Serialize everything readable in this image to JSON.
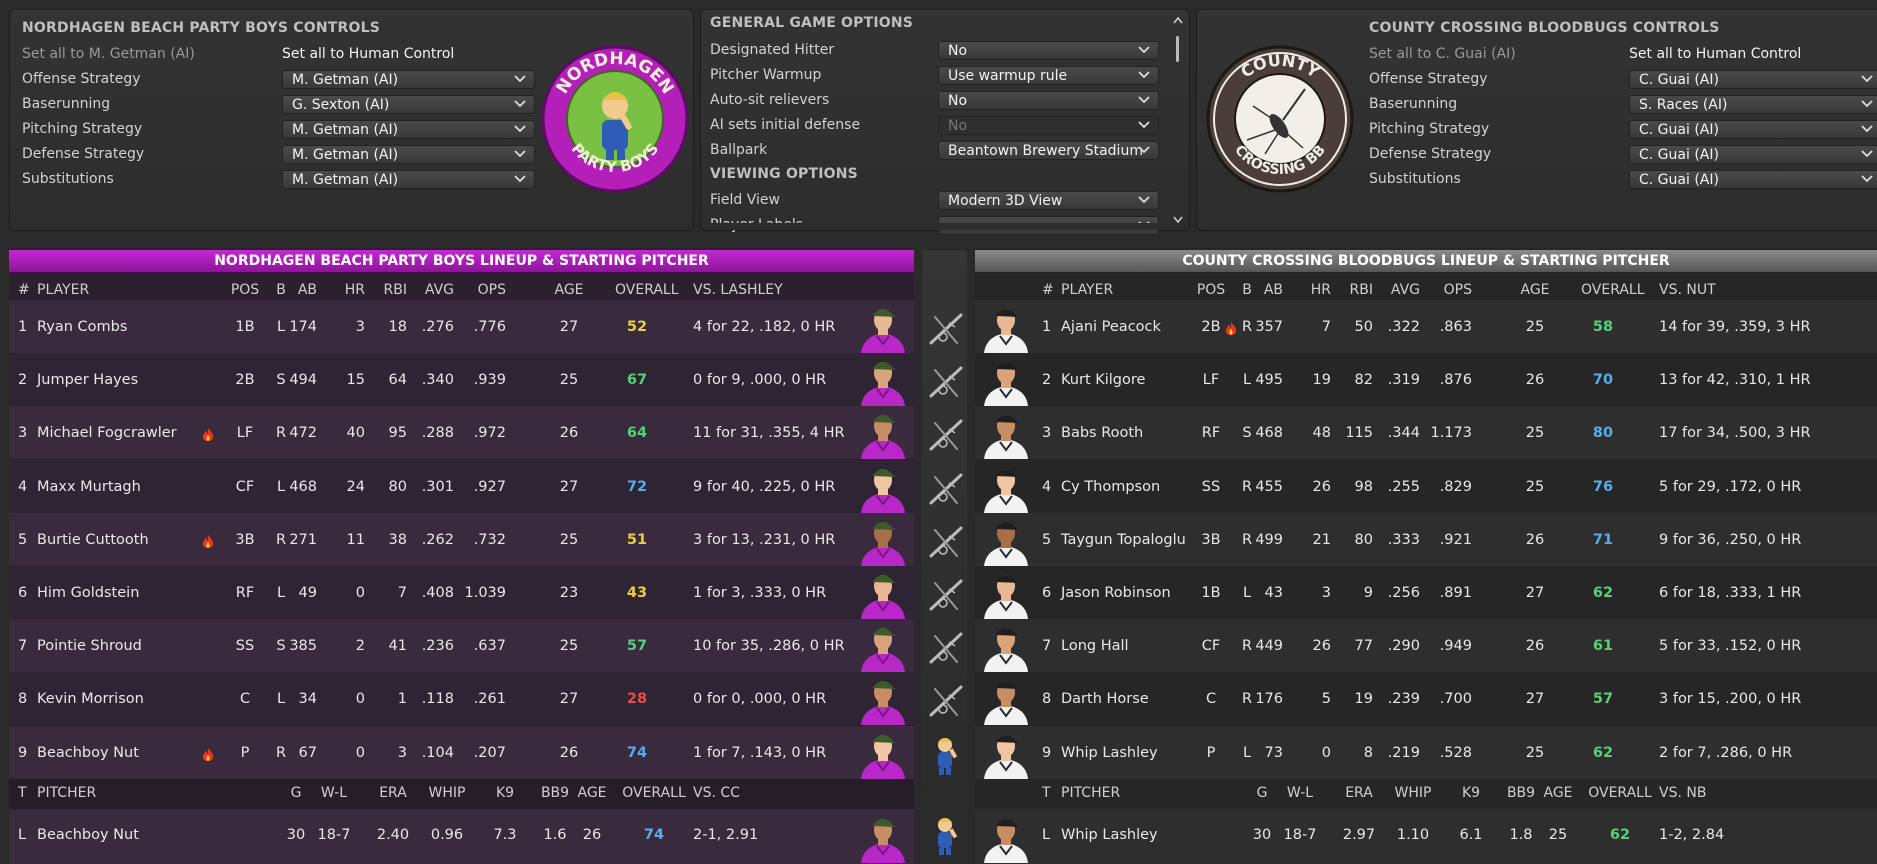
{
  "colors": {
    "away_header": "#a01ab0",
    "home_header": "#6a6a6a",
    "ovr_yellow": "#e9d13a",
    "ovr_green": "#55d07a",
    "ovr_blue": "#55aee8",
    "ovr_red": "#e84b4b"
  },
  "away_controls": {
    "title": "NORDHAGEN BEACH PARTY BOYS CONTROLS",
    "set_all_ai": "Set all to M. Getman (AI)",
    "set_all_human": "Set all to Human Control",
    "rows": [
      {
        "label": "Offense Strategy",
        "value": "M. Getman (AI)"
      },
      {
        "label": "Baserunning",
        "value": "G. Sexton (AI)"
      },
      {
        "label": "Pitching Strategy",
        "value": "M. Getman (AI)"
      },
      {
        "label": "Defense Strategy",
        "value": "M. Getman (AI)"
      },
      {
        "label": "Substitutions",
        "value": "M. Getman (AI)"
      }
    ],
    "logo_text_top": "NORDHAGEN",
    "logo_text_bottom": "PARTY BOYS"
  },
  "game_options": {
    "title": "GENERAL GAME OPTIONS",
    "rows": [
      {
        "label": "Designated Hitter",
        "value": "No"
      },
      {
        "label": "Pitcher Warmup",
        "value": "Use warmup rule"
      },
      {
        "label": "Auto-sit relievers",
        "value": "No"
      },
      {
        "label": "AI sets initial defense",
        "value": "No"
      },
      {
        "label": "Ballpark",
        "value": "Beantown Brewery Stadium"
      }
    ],
    "viewing_title": "VIEWING OPTIONS",
    "viewing_rows": [
      {
        "label": "Field View",
        "value": "Modern 3D View"
      },
      {
        "label": "Player Labels",
        "value": ""
      }
    ]
  },
  "home_controls": {
    "title": "COUNTY CROSSING BLOODBUGS CONTROLS",
    "set_all_ai": "Set all to C. Guai (AI)",
    "set_all_human": "Set all to Human Control",
    "rows": [
      {
        "label": "Offense Strategy",
        "value": "C. Guai (AI)"
      },
      {
        "label": "Baserunning",
        "value": "S. Races (AI)"
      },
      {
        "label": "Pitching Strategy",
        "value": "C. Guai (AI)"
      },
      {
        "label": "Defense Strategy",
        "value": "C. Guai (AI)"
      },
      {
        "label": "Substitutions",
        "value": "C. Guai (AI)"
      }
    ],
    "logo_text_top": "COUNTY",
    "logo_text_bottom": "CROSSING BB"
  },
  "away_lineup": {
    "title": "NORDHAGEN BEACH PARTY BOYS LINEUP & STARTING PITCHER",
    "headers": {
      "num": "#",
      "player": "PLAYER",
      "pos": "POS",
      "b": "B",
      "ab": "AB",
      "hr": "HR",
      "rbi": "RBI",
      "avg": "AVG",
      "ops": "OPS",
      "age": "AGE",
      "overall": "OVERALL",
      "vs": "VS. LASHLEY"
    },
    "players": [
      {
        "num": "1",
        "name": "Ryan Combs",
        "hot": false,
        "pos": "1B",
        "b": "L",
        "ab": "174",
        "hr": "3",
        "rbi": "18",
        "avg": ".276",
        "ops": ".776",
        "age": "27",
        "overall": "52",
        "ovr_color": "yellow",
        "vs": "4 for 22, .182, 0 HR"
      },
      {
        "num": "2",
        "name": "Jumper Hayes",
        "hot": false,
        "pos": "2B",
        "b": "S",
        "ab": "494",
        "hr": "15",
        "rbi": "64",
        "avg": ".340",
        "ops": ".939",
        "age": "25",
        "overall": "67",
        "ovr_color": "green",
        "vs": "0 for 9, .000, 0 HR"
      },
      {
        "num": "3",
        "name": "Michael Fogcrawler",
        "hot": true,
        "pos": "LF",
        "b": "R",
        "ab": "472",
        "hr": "40",
        "rbi": "95",
        "avg": ".288",
        "ops": ".972",
        "age": "26",
        "overall": "64",
        "ovr_color": "green",
        "vs": "11 for 31, .355, 4 HR"
      },
      {
        "num": "4",
        "name": "Maxx Murtagh",
        "hot": false,
        "pos": "CF",
        "b": "L",
        "ab": "468",
        "hr": "24",
        "rbi": "80",
        "avg": ".301",
        "ops": ".927",
        "age": "27",
        "overall": "72",
        "ovr_color": "blue",
        "vs": "9 for 40, .225, 0 HR"
      },
      {
        "num": "5",
        "name": "Burtie Cuttooth",
        "hot": true,
        "pos": "3B",
        "b": "R",
        "ab": "271",
        "hr": "11",
        "rbi": "38",
        "avg": ".262",
        "ops": ".732",
        "age": "25",
        "overall": "51",
        "ovr_color": "yellow",
        "vs": "3 for 13, .231, 0 HR"
      },
      {
        "num": "6",
        "name": "Him Goldstein",
        "hot": false,
        "pos": "RF",
        "b": "L",
        "ab": "49",
        "hr": "0",
        "rbi": "7",
        "avg": ".408",
        "ops": "1.039",
        "age": "23",
        "overall": "43",
        "ovr_color": "yellow",
        "vs": "1 for 3, .333, 0 HR"
      },
      {
        "num": "7",
        "name": "Pointie Shroud",
        "hot": false,
        "pos": "SS",
        "b": "S",
        "ab": "385",
        "hr": "2",
        "rbi": "41",
        "avg": ".236",
        "ops": ".637",
        "age": "25",
        "overall": "57",
        "ovr_color": "green",
        "vs": "10 for 35, .286, 0 HR"
      },
      {
        "num": "8",
        "name": "Kevin Morrison",
        "hot": false,
        "pos": "C",
        "b": "L",
        "ab": "34",
        "hr": "0",
        "rbi": "1",
        "avg": ".118",
        "ops": ".261",
        "age": "27",
        "overall": "28",
        "ovr_color": "red",
        "vs": "0 for 0, .000, 0 HR"
      },
      {
        "num": "9",
        "name": "Beachboy Nut",
        "hot": true,
        "pos": "P",
        "b": "R",
        "ab": "67",
        "hr": "0",
        "rbi": "3",
        "avg": ".104",
        "ops": ".207",
        "age": "26",
        "overall": "74",
        "ovr_color": "blue",
        "vs": "1 for 7, .143, 0 HR"
      }
    ],
    "pitcher_headers": {
      "t": "T",
      "pitcher": "PITCHER",
      "g": "G",
      "wl": "W-L",
      "era": "ERA",
      "whip": "WHIP",
      "k9": "K9",
      "bb9": "BB9",
      "age": "AGE",
      "overall": "OVERALL",
      "vs": "VS. CC"
    },
    "pitcher": {
      "t": "L",
      "name": "Beachboy Nut",
      "g": "30",
      "wl": "18-7",
      "era": "2.40",
      "whip": "0.96",
      "k9": "7.3",
      "bb9": "1.6",
      "age": "26",
      "overall": "74",
      "ovr_color": "blue",
      "vs": "2-1, 2.91"
    }
  },
  "home_lineup": {
    "title": "COUNTY CROSSING BLOODBUGS LINEUP & STARTING PITCHER",
    "headers": {
      "num": "#",
      "player": "PLAYER",
      "pos": "POS",
      "b": "B",
      "ab": "AB",
      "hr": "HR",
      "rbi": "RBI",
      "avg": "AVG",
      "ops": "OPS",
      "age": "AGE",
      "overall": "OVERALL",
      "vs": "VS. NUT"
    },
    "players": [
      {
        "num": "1",
        "name": "Ajani Peacock",
        "hot": true,
        "pos": "2B",
        "b": "R",
        "ab": "357",
        "hr": "7",
        "rbi": "50",
        "avg": ".322",
        "ops": ".863",
        "age": "25",
        "overall": "58",
        "ovr_color": "green",
        "vs": "14 for 39, .359, 3 HR"
      },
      {
        "num": "2",
        "name": "Kurt Kilgore",
        "hot": false,
        "pos": "LF",
        "b": "L",
        "ab": "495",
        "hr": "19",
        "rbi": "82",
        "avg": ".319",
        "ops": ".876",
        "age": "26",
        "overall": "70",
        "ovr_color": "blue",
        "vs": "13 for 42, .310, 1 HR"
      },
      {
        "num": "3",
        "name": "Babs Rooth",
        "hot": false,
        "pos": "RF",
        "b": "S",
        "ab": "468",
        "hr": "48",
        "rbi": "115",
        "avg": ".344",
        "ops": "1.173",
        "age": "25",
        "overall": "80",
        "ovr_color": "blue",
        "vs": "17 for 34, .500, 3 HR"
      },
      {
        "num": "4",
        "name": "Cy Thompson",
        "hot": false,
        "pos": "SS",
        "b": "R",
        "ab": "455",
        "hr": "26",
        "rbi": "98",
        "avg": ".255",
        "ops": ".829",
        "age": "25",
        "overall": "76",
        "ovr_color": "blue",
        "vs": "5 for 29, .172, 0 HR"
      },
      {
        "num": "5",
        "name": "Taygun Topaloglu",
        "hot": false,
        "pos": "3B",
        "b": "R",
        "ab": "499",
        "hr": "21",
        "rbi": "80",
        "avg": ".333",
        "ops": ".921",
        "age": "26",
        "overall": "71",
        "ovr_color": "blue",
        "vs": "9 for 36, .250, 0 HR"
      },
      {
        "num": "6",
        "name": "Jason Robinson",
        "hot": false,
        "pos": "1B",
        "b": "L",
        "ab": "43",
        "hr": "3",
        "rbi": "9",
        "avg": ".256",
        "ops": ".891",
        "age": "27",
        "overall": "62",
        "ovr_color": "green",
        "vs": "6 for 18, .333, 1 HR"
      },
      {
        "num": "7",
        "name": "Long Hall",
        "hot": false,
        "pos": "CF",
        "b": "R",
        "ab": "449",
        "hr": "26",
        "rbi": "77",
        "avg": ".290",
        "ops": ".949",
        "age": "26",
        "overall": "61",
        "ovr_color": "green",
        "vs": "5 for 33, .152, 0 HR"
      },
      {
        "num": "8",
        "name": "Darth Horse",
        "hot": false,
        "pos": "C",
        "b": "R",
        "ab": "176",
        "hr": "5",
        "rbi": "19",
        "avg": ".239",
        "ops": ".700",
        "age": "27",
        "overall": "57",
        "ovr_color": "green",
        "vs": "3 for 15, .200, 0 HR"
      },
      {
        "num": "9",
        "name": "Whip Lashley",
        "hot": false,
        "pos": "P",
        "b": "L",
        "ab": "73",
        "hr": "0",
        "rbi": "8",
        "avg": ".219",
        "ops": ".528",
        "age": "25",
        "overall": "62",
        "ovr_color": "green",
        "vs": "2 for 7, .286, 0 HR"
      }
    ],
    "pitcher_headers": {
      "t": "T",
      "pitcher": "PITCHER",
      "g": "G",
      "wl": "W-L",
      "era": "ERA",
      "whip": "WHIP",
      "k9": "K9",
      "bb9": "BB9",
      "age": "AGE",
      "overall": "OVERALL",
      "vs": "VS. NB"
    },
    "pitcher": {
      "t": "L",
      "name": "Whip Lashley",
      "g": "30",
      "wl": "18-7",
      "era": "2.97",
      "whip": "1.10",
      "k9": "6.1",
      "bb9": "1.8",
      "age": "25",
      "overall": "62",
      "ovr_color": "green",
      "vs": "1-2, 2.84"
    }
  }
}
